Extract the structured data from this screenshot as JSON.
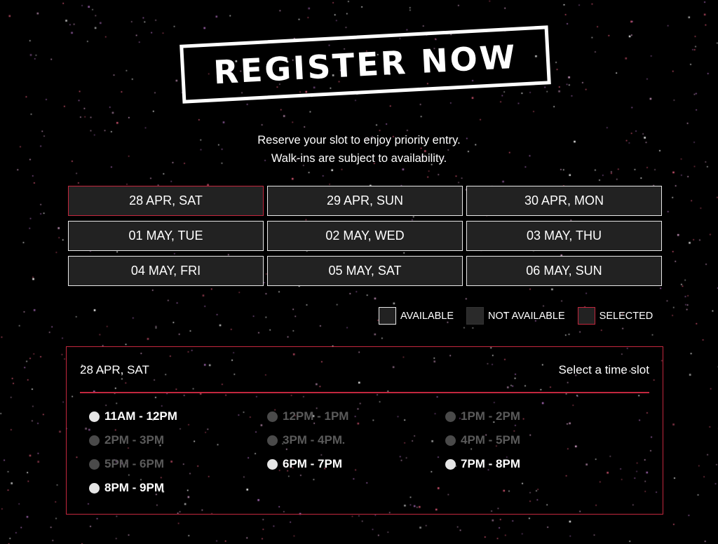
{
  "title": "REGISTER NOW",
  "subtitle": {
    "line1": "Reserve your slot to enjoy priority entry.",
    "line2": "Walk-ins are subject to availability."
  },
  "dates": [
    {
      "label": "28 APR, SAT",
      "state": "selected"
    },
    {
      "label": "29 APR, SUN",
      "state": "available"
    },
    {
      "label": "30 APR, MON",
      "state": "available"
    },
    {
      "label": "01 MAY, TUE",
      "state": "available"
    },
    {
      "label": "02 MAY, WED",
      "state": "available"
    },
    {
      "label": "03 MAY, THU",
      "state": "available"
    },
    {
      "label": "04 MAY, FRI",
      "state": "available"
    },
    {
      "label": "05 MAY, SAT",
      "state": "available"
    },
    {
      "label": "06 MAY, SUN",
      "state": "available"
    }
  ],
  "legend": {
    "available": "AVAILABLE",
    "not_available": "NOT AVAILABLE",
    "selected": "SELECTED"
  },
  "slot_panel": {
    "date": "28 APR, SAT",
    "hint": "Select a time slot",
    "slots": [
      {
        "label": "11AM - 12PM",
        "available": true
      },
      {
        "label": "12PM - 1PM",
        "available": false
      },
      {
        "label": "1PM - 2PM",
        "available": false
      },
      {
        "label": "2PM - 3PM",
        "available": false
      },
      {
        "label": "3PM - 4PM",
        "available": false
      },
      {
        "label": "4PM - 5PM",
        "available": false
      },
      {
        "label": "5PM - 6PM",
        "available": false
      },
      {
        "label": "6PM - 7PM",
        "available": true
      },
      {
        "label": "7PM - 8PM",
        "available": true
      },
      {
        "label": "8PM - 9PM",
        "available": true
      }
    ]
  },
  "colors": {
    "background": "#000000",
    "accent_selected": "#c3273e",
    "button_bg": "#222222",
    "border_available": "#e8e8e8",
    "unavailable_text": "#5a5a5a",
    "star_colors": [
      "#ffffff",
      "#d4a0c8",
      "#e05a78",
      "#b070c0"
    ]
  }
}
